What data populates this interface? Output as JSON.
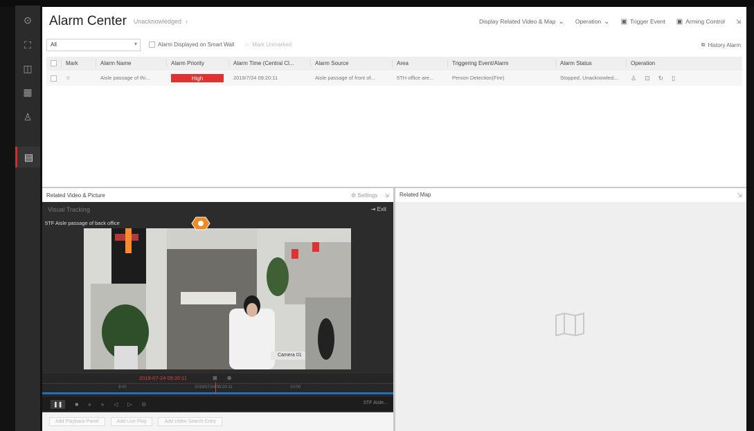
{
  "nav": {
    "icons": [
      "home-icon",
      "network-icon",
      "grid-icon",
      "table-icon",
      "person-icon",
      "alarm-center-icon"
    ]
  },
  "header": {
    "title": "Alarm Center",
    "subtitle": "Unacknowledged",
    "subtitle_chevron": "›",
    "actions": [
      {
        "label": "Display Related Video & Map",
        "icon": "⌄"
      },
      {
        "label": "Operation",
        "icon": "⌄"
      },
      {
        "label": "Trigger Event",
        "icon": "▣"
      },
      {
        "label": "Arming Control",
        "icon": "▣"
      }
    ],
    "expand_icon": "⇲"
  },
  "filters": {
    "select_value": "All",
    "checkbox_label": "Alarm Displayed on Smart Wall",
    "mark_label": "Mark Unmarked",
    "history_label": "History Alarm"
  },
  "table": {
    "headers": [
      "Mark",
      "Alarm Name",
      "Alarm Priority",
      "Alarm Time (Central Cl...",
      "Alarm Source",
      "Area",
      "Triggering Event/Alarm",
      "Alarm Status",
      "Operation"
    ],
    "row": {
      "mark": "☆",
      "alarm_name": "Aisle passage of thi...",
      "priority": "High",
      "time": "2019/7/24 09:20:11",
      "source": "Aisle passage of front of...",
      "area": "5TH office are...",
      "event": "Person Detection(Fire)",
      "status": "Stopped, Unacknowled..."
    }
  },
  "video_panel": {
    "title": "Related Video & Picture",
    "settings_label": "Settings",
    "tracking_label": "Visual Tracking",
    "exit_label": "Exit",
    "camera_label": "5TF Aisle passage of back office",
    "time_text": "2019-07-24 09:20:11",
    "camera_overlay": "Camera 01",
    "timeline_left": "9:00",
    "timeline_mid": "2019/07/24 09:20:11",
    "timeline_right": "10:00",
    "controls_right": "5TF Aisle...",
    "footer_buttons": [
      "Add Playback Panel",
      "Add Live Play",
      "Add Video Search Entry"
    ]
  },
  "map_panel": {
    "title": "Related Map"
  },
  "colors": {
    "priority_high": "#e23131",
    "timeline": "#1e6fc4",
    "nav_active": "#d42b2b"
  }
}
